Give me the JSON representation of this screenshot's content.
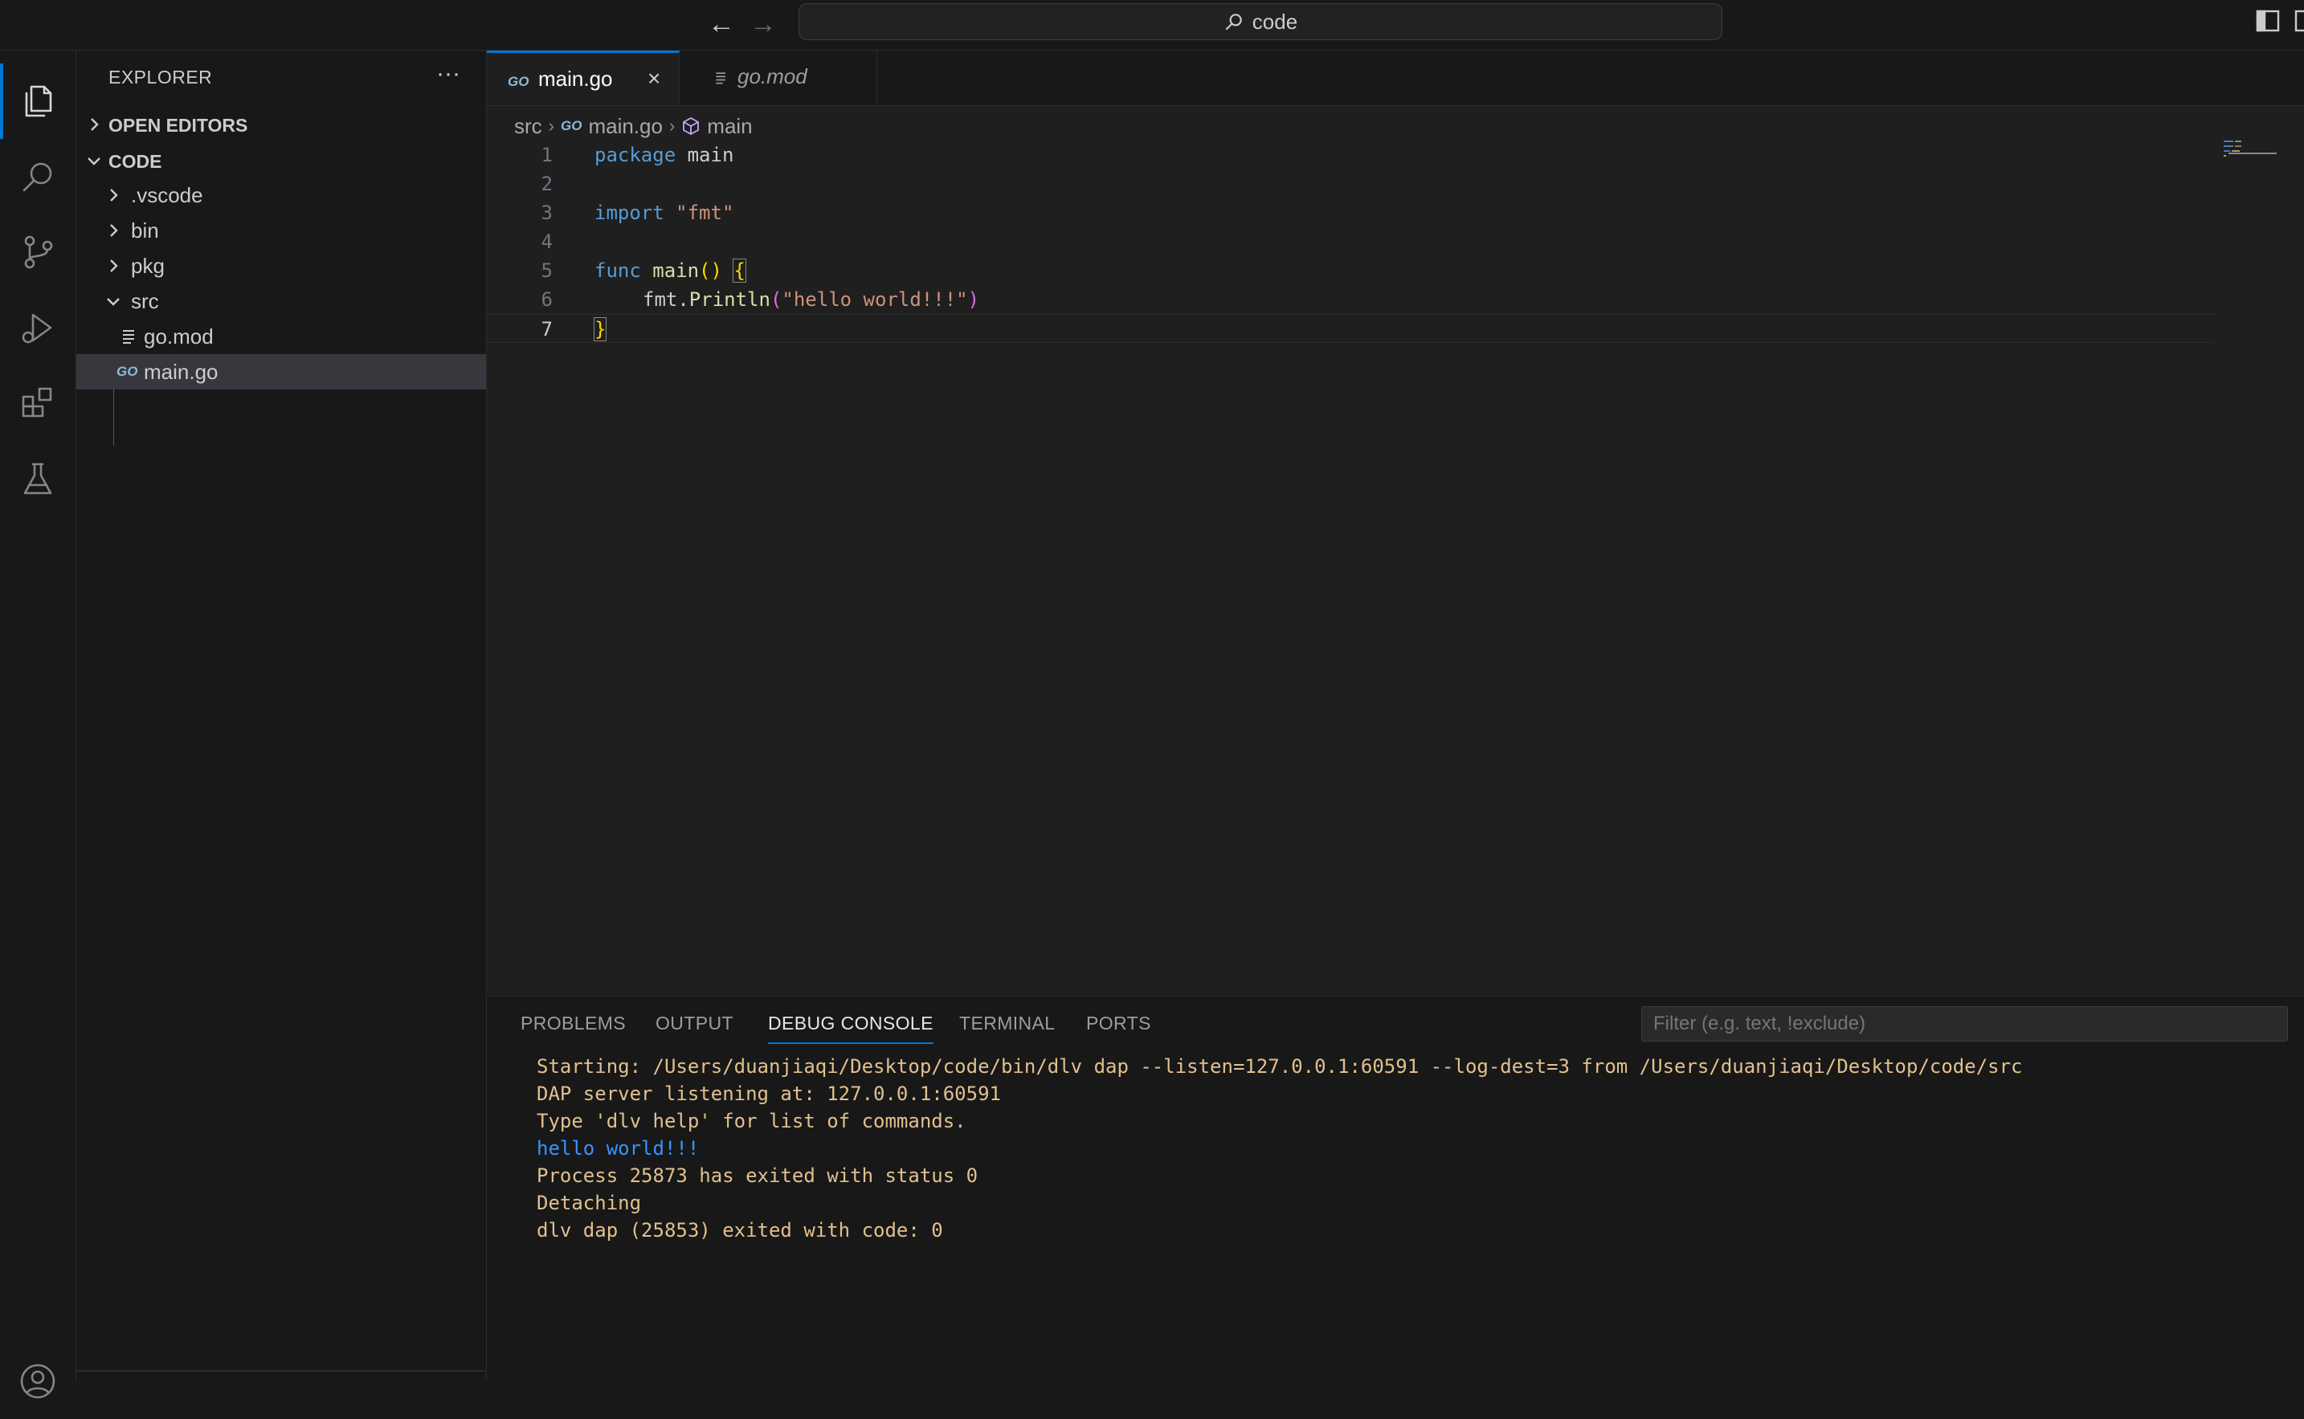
{
  "titlebar": {
    "search_text": "code"
  },
  "activity_bar": {
    "items": [
      "explorer",
      "search",
      "source-control",
      "run-and-debug",
      "extensions",
      "testing",
      "accounts"
    ]
  },
  "sidebar": {
    "title": "EXPLORER",
    "more": "···",
    "sections": {
      "open_editors": "OPEN EDITORS",
      "folder": "CODE"
    },
    "tree": [
      {
        "label": ".vscode",
        "type": "folder",
        "expanded": false
      },
      {
        "label": "bin",
        "type": "folder",
        "expanded": false
      },
      {
        "label": "pkg",
        "type": "folder",
        "expanded": false
      },
      {
        "label": "src",
        "type": "folder",
        "expanded": true
      },
      {
        "label": "go.mod",
        "type": "file"
      },
      {
        "label": "main.go",
        "type": "file",
        "selected": true
      }
    ],
    "go_icon_text": "GO"
  },
  "editor": {
    "tabs": [
      {
        "label": "main.go",
        "active": true,
        "close": "×"
      },
      {
        "label": "go.mod",
        "active": false
      }
    ],
    "breadcrumb": [
      "src",
      "main.go",
      "main"
    ],
    "line_numbers": [
      "1",
      "2",
      "3",
      "4",
      "5",
      "6",
      "7"
    ],
    "code": {
      "l1_kw": "package",
      "l1_rest": " main",
      "l3_kw": "import",
      "l3_str": "\"fmt\"",
      "l5_kw": "func",
      "l5_fn": "main",
      "l5_parens": "()",
      "l5_brace": "{",
      "l6_pkg": "fmt.",
      "l6_fn": "Println",
      "l6_open": "(",
      "l6_str": "\"hello world!!!\"",
      "l6_close": ")",
      "l7_brace": "}"
    }
  },
  "panel": {
    "tabs": [
      "PROBLEMS",
      "OUTPUT",
      "DEBUG CONSOLE",
      "TERMINAL",
      "PORTS"
    ],
    "active_tab": "DEBUG CONSOLE",
    "filter_placeholder": "Filter (e.g. text, !exclude)",
    "console_lines": [
      "Starting: /Users/duanjiaqi/Desktop/code/bin/dlv dap --listen=127.0.0.1:60591 --log-dest=3 from /Users/duanjiaqi/Desktop/code/src",
      "DAP server listening at: 127.0.0.1:60591",
      "Type 'dlv help' for list of commands.",
      "hello world!!!",
      "Process 25873 has exited with status 0",
      "Detaching",
      "dlv dap (25853) exited with code: 0"
    ]
  },
  "colors": {
    "accent": "#0078d4",
    "console_info": "#e2c08d",
    "console_output": "#3794ff"
  }
}
